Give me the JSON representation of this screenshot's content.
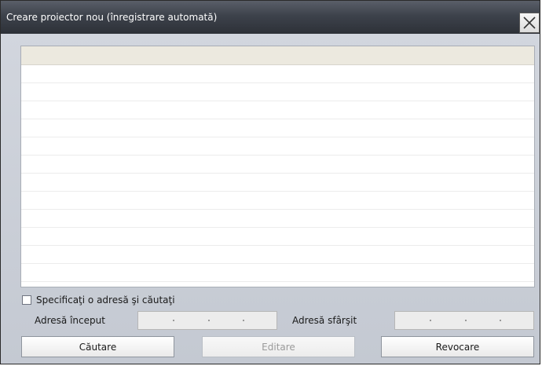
{
  "window": {
    "title": "Creare proiector nou (înregistrare automată)"
  },
  "list": {
    "rows": 12
  },
  "search": {
    "checkbox_label": "Specificaţi o adresă şi căutaţi",
    "checked": false,
    "start_label": "Adresă început",
    "end_label": "Adresă sfârşit",
    "start_value": "",
    "end_value": ""
  },
  "buttons": {
    "search": "Căutare",
    "edit": "Editare",
    "cancel": "Revocare"
  },
  "colors": {
    "titlebar": "#3d424b",
    "window_bg": "#c9cdd5",
    "list_header": "#ece9df"
  }
}
